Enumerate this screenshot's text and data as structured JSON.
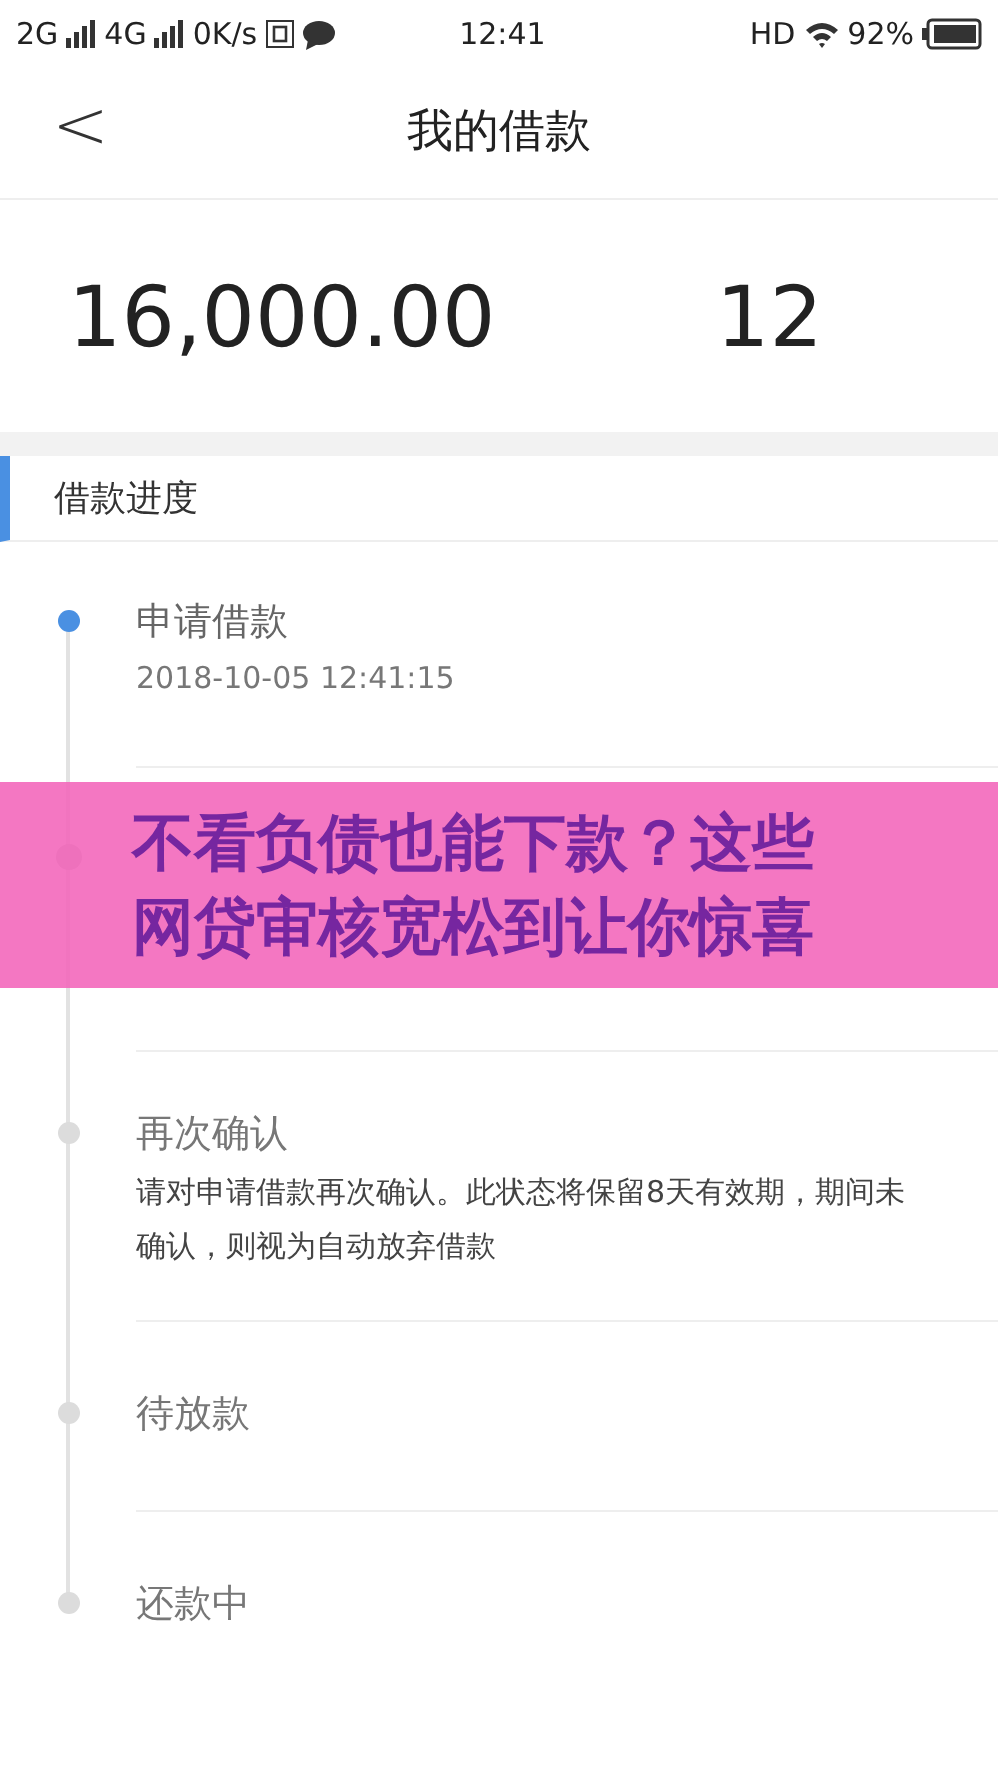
{
  "status_bar": {
    "left": [
      "2G",
      "4G",
      "0K/s"
    ],
    "time": "12:41",
    "hd": "HD",
    "battery": "92%"
  },
  "header": {
    "back": "<",
    "title": "我的借款"
  },
  "summary": {
    "amount": "16,000.00",
    "periods": "12"
  },
  "section": {
    "title": "借款进度"
  },
  "steps": [
    {
      "title": "申请借款",
      "lines": [
        "2018-10-05 12:41:15"
      ],
      "done": true,
      "kind": "dated"
    },
    {
      "kind": "covered"
    },
    {
      "title": "再次确认",
      "lines": [
        "请对申请借款再次确认。此状态将保留8天有效期，期间未确认，则视为自动放弃借款"
      ],
      "done": false,
      "kind": "described"
    },
    {
      "title": "待放款",
      "done": false,
      "kind": "plain"
    },
    {
      "title": "还款中",
      "done": false,
      "kind": "plain"
    }
  ],
  "banner": {
    "lines": [
      "不看负债也能下款？这些",
      "网贷审核宽松到让你惊喜"
    ]
  }
}
